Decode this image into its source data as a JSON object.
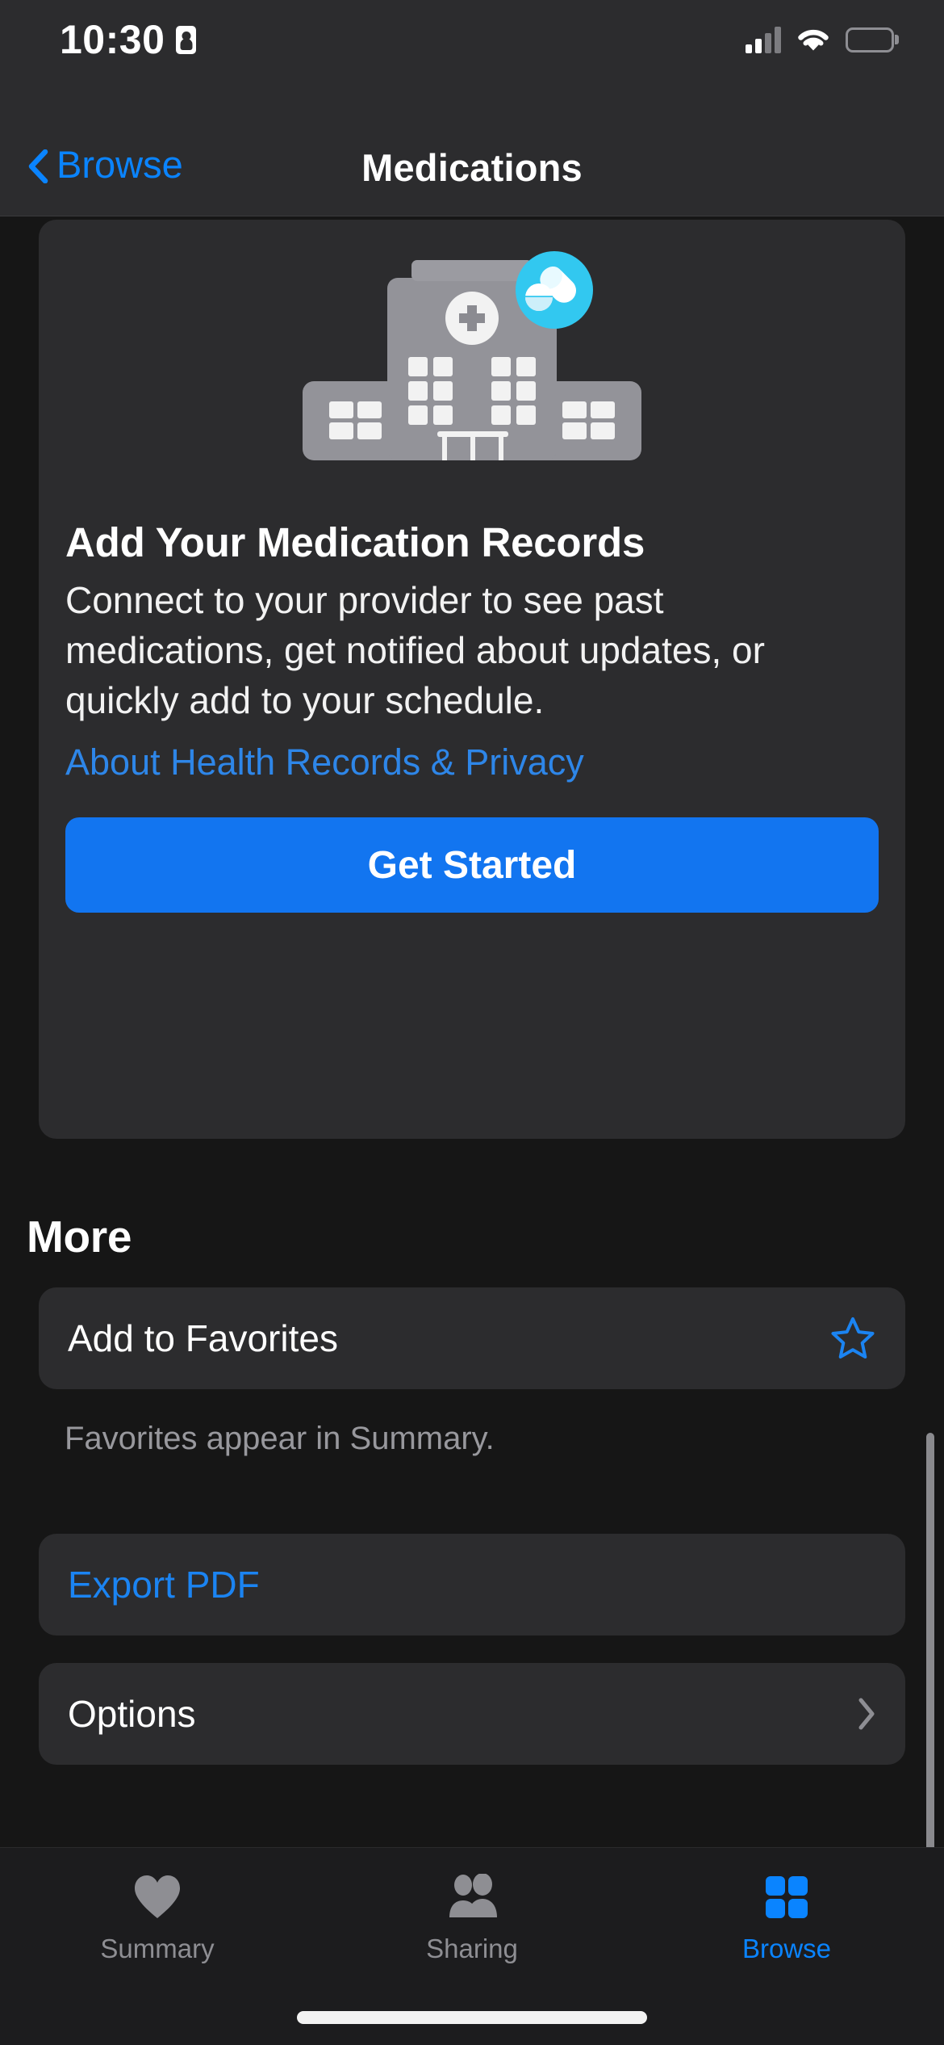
{
  "status_bar": {
    "time": "10:30",
    "recording_icon": "screen-recording-icon",
    "cellular_icon": "cellular-signal-icon",
    "wifi_icon": "wifi-icon",
    "battery_icon": "battery-icon",
    "battery_color": "#F5D20C"
  },
  "nav": {
    "back_label": "Browse",
    "back_icon": "chevron-left-icon",
    "title": "Medications"
  },
  "hero": {
    "illustration": "hospital-with-pills-badge-illustration",
    "title": "Add Your Medication Records",
    "body": "Connect to your provider to see past medications, get notified about updates, or quickly add to your schedule.",
    "link_label": "About Health Records & Privacy",
    "cta_label": "Get Started",
    "cta_color": "#1275F0",
    "link_color": "#2E86E8"
  },
  "more": {
    "header": "More",
    "rows": [
      {
        "label": "Add to Favorites",
        "accessory": "star-outline-icon",
        "accessory_color": "#1B84F2",
        "is_link": false
      },
      {
        "label": "Export PDF",
        "accessory": "none",
        "accessory_color": "",
        "is_link": true
      },
      {
        "label": "Options",
        "accessory": "chevron-right-icon",
        "accessory_color": "#8E8E93",
        "is_link": false
      }
    ],
    "footnote": "Favorites appear in Summary."
  },
  "tabbar": {
    "tabs": [
      {
        "label": "Summary",
        "icon": "heart-icon",
        "active": false
      },
      {
        "label": "Sharing",
        "icon": "people-icon",
        "active": false
      },
      {
        "label": "Browse",
        "icon": "grid-squares-icon",
        "active": true
      }
    ],
    "active_color": "#0A84FF",
    "inactive_color": "#8E8E93"
  }
}
